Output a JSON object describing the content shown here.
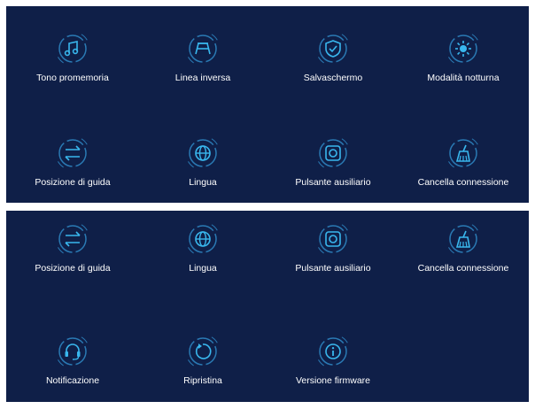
{
  "colors": {
    "panel_bg": "#0f1f48",
    "icon_stroke": "#39b7ee",
    "icon_ring": "#2a7ab4",
    "label": "#ffffff",
    "frame": "#ffffff"
  },
  "top_panel": {
    "items": [
      {
        "id": "tone",
        "label": "Tono promemoria",
        "icon": "music-note-icon"
      },
      {
        "id": "reverse",
        "label": "Linea inversa",
        "icon": "car-reverse-icon"
      },
      {
        "id": "screensaver",
        "label": "Salvaschermo",
        "icon": "shield-check-icon"
      },
      {
        "id": "night",
        "label": "Modalità notturna",
        "icon": "sun-icon"
      },
      {
        "id": "driving",
        "label": "Posizione di guida",
        "icon": "swap-arrows-icon"
      },
      {
        "id": "language",
        "label": "Lingua",
        "icon": "globe-icon"
      },
      {
        "id": "aux",
        "label": "Pulsante ausiliario",
        "icon": "aux-button-icon"
      },
      {
        "id": "clear",
        "label": "Cancella connessione",
        "icon": "broom-icon"
      }
    ]
  },
  "bottom_panel": {
    "items": [
      {
        "id": "driving",
        "label": "Posizione di guida",
        "icon": "swap-arrows-icon"
      },
      {
        "id": "language",
        "label": "Lingua",
        "icon": "globe-icon"
      },
      {
        "id": "aux",
        "label": "Pulsante ausiliario",
        "icon": "aux-button-icon"
      },
      {
        "id": "clear",
        "label": "Cancella connessione",
        "icon": "broom-icon"
      },
      {
        "id": "notify",
        "label": "Notificazione",
        "icon": "headset-icon"
      },
      {
        "id": "reset",
        "label": "Ripristina",
        "icon": "reset-icon"
      },
      {
        "id": "firmware",
        "label": "Versione firmware",
        "icon": "info-icon"
      }
    ]
  }
}
